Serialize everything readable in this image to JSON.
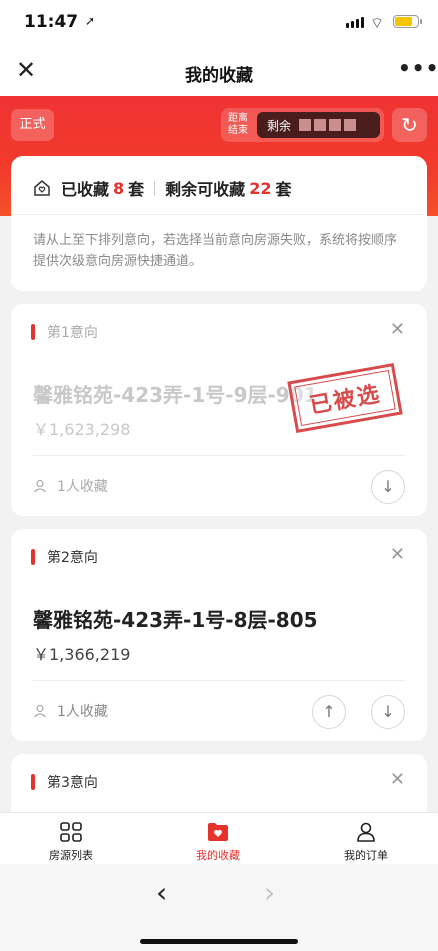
{
  "status": {
    "time": "11:47",
    "location_glyph": "➚",
    "wifi_glyph": "⌔"
  },
  "navbar": {
    "close": "✕",
    "title": "我的收藏",
    "more": "•••"
  },
  "header": {
    "official": "正式",
    "countdown_label_1": "距离",
    "countdown_label_2": "结束",
    "remaining": "剩余",
    "refresh": "↻"
  },
  "summary": {
    "collected_prefix": "已收藏",
    "collected_count": "8",
    "collected_unit": "套",
    "remaining_prefix": "剩余可收藏",
    "remaining_count": "22",
    "remaining_unit": "套",
    "description": "请从上至下排列意向，若选择当前意向房源失败，系统将按顺序提供次级意向房源快捷通道。"
  },
  "preferences": [
    {
      "label": "第1意向",
      "name": "馨雅铭苑-423弄-1号-9层-901",
      "price": "￥1,623,298",
      "favorites": "1人收藏",
      "stamp": "已被选",
      "status": "taken"
    },
    {
      "label": "第2意向",
      "name": "馨雅铭苑-423弄-1号-8层-805",
      "price": "￥1,366,219",
      "favorites": "1人收藏",
      "status": "available"
    },
    {
      "label": "第3意向"
    }
  ],
  "tabbar": {
    "items": [
      {
        "label": "房源列表",
        "icon": "grid-icon"
      },
      {
        "label": "我的收藏",
        "icon": "heart-folder-icon",
        "active": true
      },
      {
        "label": "我的订单",
        "icon": "user-icon"
      }
    ]
  },
  "browser": {
    "back": "‹",
    "forward": "›"
  },
  "colors": {
    "accent": "#e4322d",
    "header_red": "#ef3333"
  }
}
